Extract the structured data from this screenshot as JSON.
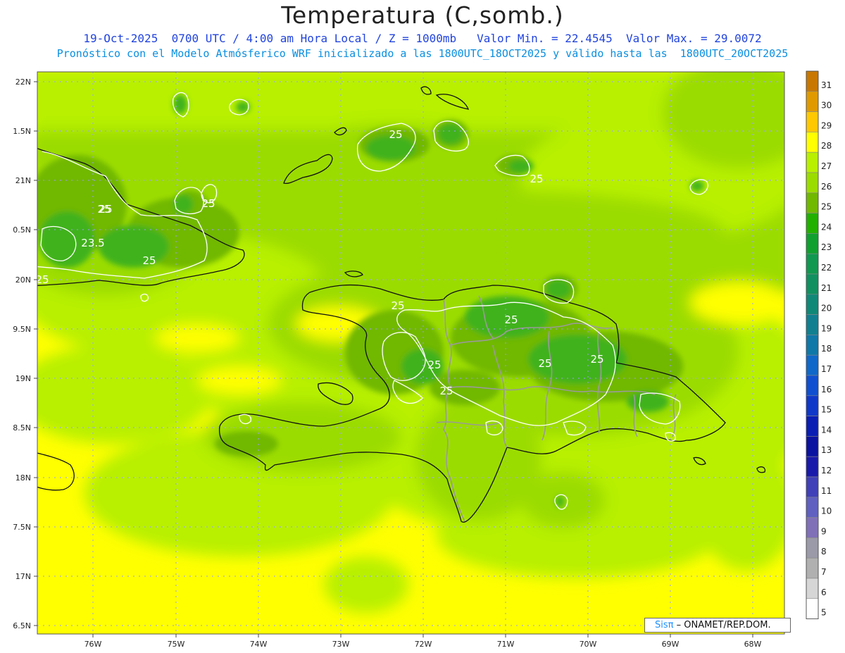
{
  "title": "Temperatura (C,somb.)",
  "subtitle_line1": "19-Oct-2025  0700 UTC / 4:00 am Hora Local / Z = 1000mb   Valor Min. = 22.4545  Valor Max. = 29.0072",
  "subtitle_line2": "Pronóstico con el Modelo Atmósferico WRF inicializado a las 1800UTC_18OCT2025 y válido hasta las  1800UTC_20OCT2025",
  "credit": {
    "brand": "Sisπ",
    "text": " – ONAMET/REP.DOM."
  },
  "map": {
    "lat_labels": [
      "22N",
      "1.5N",
      "21N",
      "0.5N",
      "20N",
      "9.5N",
      "19N",
      "8.5N",
      "18N",
      "7.5N",
      "17N",
      "6.5N"
    ],
    "lon_labels": [
      "76W",
      "75W",
      "74W",
      "73W",
      "72W",
      "71W",
      "70W",
      "69W",
      "68W"
    ],
    "contour_labels": [
      "25",
      "25",
      "25",
      "25",
      "23.5",
      "25",
      "25",
      "25",
      "25",
      "25",
      "25",
      "25",
      "25",
      "25",
      "25"
    ],
    "colors": {
      "bg_warm": "#ffff00",
      "c26": "#9bdc00",
      "c27": "#b8f000",
      "c25": "#71b800",
      "c24": "#3fb21a",
      "c23": "#22a03a",
      "coast": "#111111",
      "border": "#999999",
      "grid": "#9a9aff"
    }
  },
  "colorbar": {
    "labels": [
      "31",
      "30",
      "29",
      "28",
      "27",
      "26",
      "25",
      "24",
      "23",
      "22",
      "21",
      "20",
      "19",
      "18",
      "17",
      "16",
      "15",
      "14",
      "13",
      "12",
      "11",
      "10",
      "9",
      "8",
      "7",
      "6",
      "5"
    ],
    "colors": [
      "#c87800",
      "#e09a00",
      "#ffc800",
      "#ffff00",
      "#b8f000",
      "#9bdc00",
      "#71b800",
      "#22b000",
      "#10a030",
      "#109850",
      "#109060",
      "#108878",
      "#108090",
      "#0f78a8",
      "#1068c8",
      "#1050d0",
      "#1038c8",
      "#0a1eb4",
      "#0a12a0",
      "#1a1aaa",
      "#4040b8",
      "#6060c0",
      "#8070b8",
      "#9a9aa8",
      "#b0b0b0",
      "#d6d6d6",
      "#ffffff"
    ]
  }
}
